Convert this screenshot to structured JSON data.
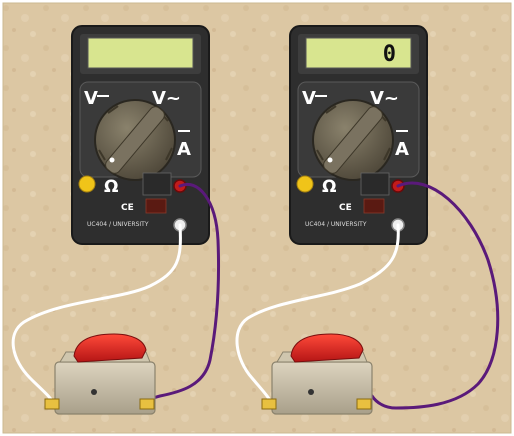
{
  "multimeters": [
    {
      "display": "",
      "labels": {
        "vdc": "V",
        "vac": "V~",
        "amp": "A",
        "ohm": "Ω"
      },
      "brand": "UC404 / UNIVERSITY"
    },
    {
      "display": "0",
      "labels": {
        "vdc": "V",
        "vac": "V~",
        "amp": "A",
        "ohm": "Ω"
      },
      "brand": "UC404 / UNIVERSITY"
    }
  ],
  "switches": [
    {
      "state": "unknown"
    },
    {
      "state": "unknown"
    }
  ],
  "colors": {
    "background": "#dcc7a3",
    "meter_body": "#2f2f2f",
    "lcd": "#d8e58f",
    "wire_white": "#ffffff",
    "wire_purple": "#5a1a7a",
    "switch_red": "#d42020",
    "switch_base": "#c9c0a9",
    "knob": "#6a6250"
  }
}
